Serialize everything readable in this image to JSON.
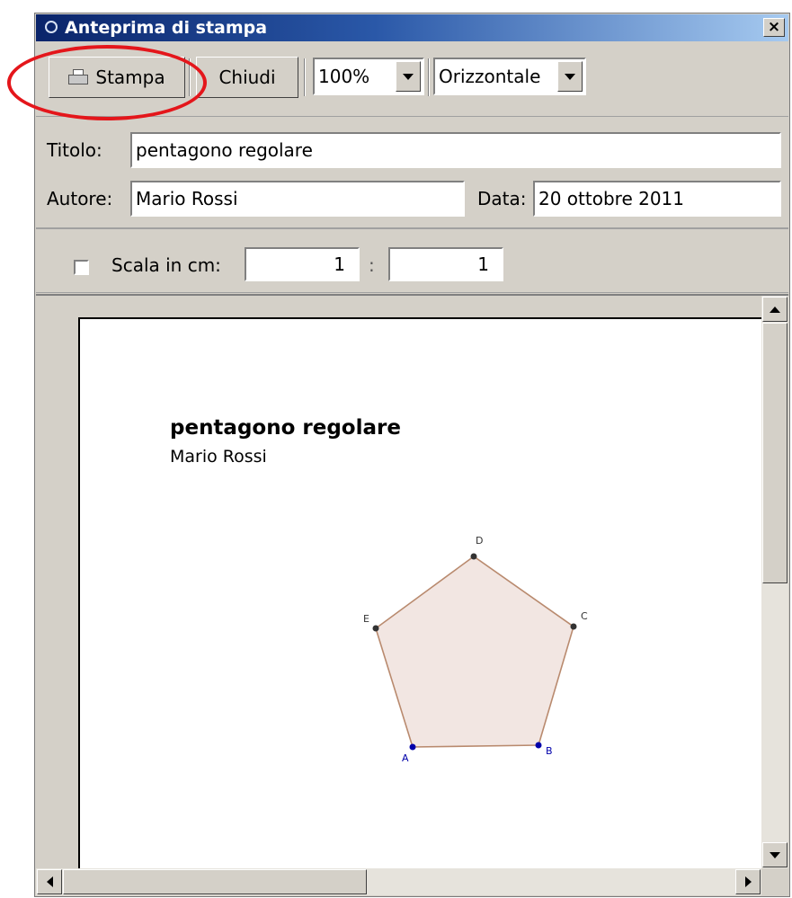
{
  "window": {
    "title": "Anteprima di stampa"
  },
  "toolbar": {
    "print_label": "Stampa",
    "close_label": "Chiudi",
    "zoom_value": "100%",
    "orientation_value": "Orizzontale"
  },
  "form": {
    "title_label": "Titolo:",
    "title_value": "pentagono regolare",
    "author_label": "Autore:",
    "author_value": "Mario Rossi",
    "date_label": "Data:",
    "date_value": "20 ottobre 2011"
  },
  "scale": {
    "checkbox_label": "Scala in cm:",
    "checked": false,
    "numerator": "1",
    "separator": ":",
    "denominator": "1"
  },
  "preview": {
    "doc_title": "pentagono regolare",
    "doc_author": "Mario Rossi",
    "pentagon": {
      "fill": "#f2e6e2",
      "stroke": "#b98a6e",
      "vertices": [
        {
          "label": "A",
          "color": "#0000aa"
        },
        {
          "label": "B",
          "color": "#0000aa"
        },
        {
          "label": "C",
          "color": "#333333"
        },
        {
          "label": "D",
          "color": "#333333"
        },
        {
          "label": "E",
          "color": "#333333"
        }
      ]
    }
  },
  "icons": [
    "printer-icon",
    "close-icon",
    "chevron-down-icon",
    "scroll-up-icon",
    "scroll-down-icon",
    "scroll-left-icon",
    "scroll-right-icon"
  ],
  "colors": {
    "titlebar": "#0a246a",
    "highlight": "#e4161b"
  }
}
